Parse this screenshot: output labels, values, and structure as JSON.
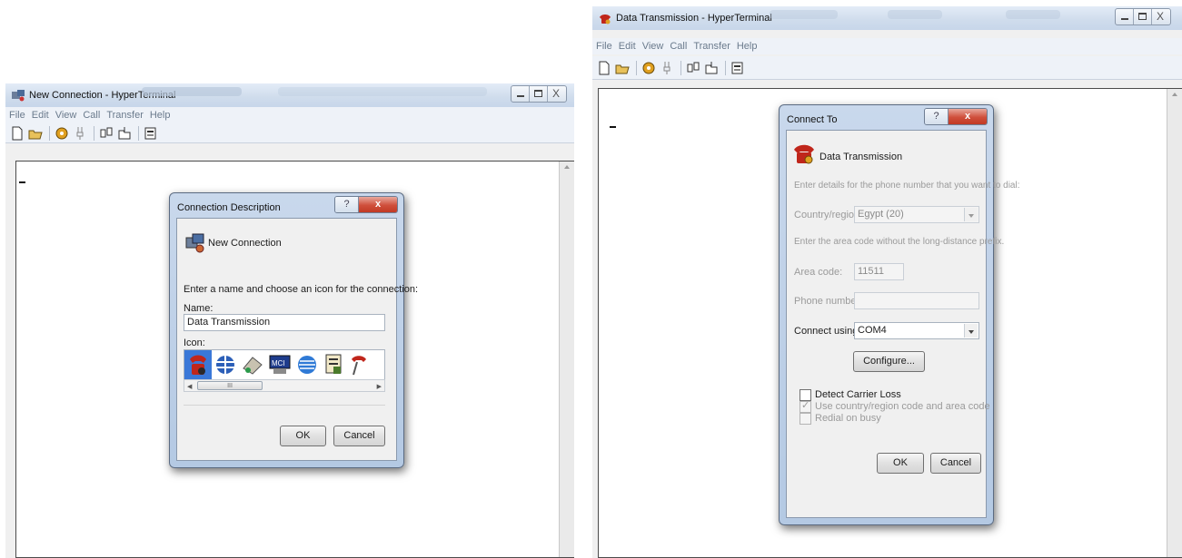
{
  "left_window": {
    "title": "New Connection - HyperTerminal",
    "menu": [
      "File",
      "Edit",
      "View",
      "Call",
      "Transfer",
      "Help"
    ],
    "dialog": {
      "title": "Connection Description",
      "help_glyph": "?",
      "close_glyph": "x",
      "header": "New Connection",
      "instruction": "Enter a name and choose an icon for the connection:",
      "name_label": "Name:",
      "name_value": "Data Transmission",
      "icon_label": "Icon:",
      "icon_names": [
        "phone-icon",
        "globe-icon",
        "dataset-icon",
        "mci-icon",
        "att-icon",
        "notebook-icon",
        "phone-red-icon"
      ],
      "mci_text": "MCI",
      "scroll_thumb": "III",
      "ok": "OK",
      "cancel": "Cancel"
    }
  },
  "right_window": {
    "title": "Data Transmission - HyperTerminal",
    "menu": [
      "File",
      "Edit",
      "View",
      "Call",
      "Transfer",
      "Help"
    ],
    "dialog": {
      "title": "Connect To",
      "help_glyph": "?",
      "close_glyph": "x",
      "header": "Data Transmission",
      "phone_details": "Enter details for the phone number that you want to dial:",
      "country_label": "Country/region:",
      "country_value": "Egypt (20)",
      "area_hint": "Enter the area code without the long-distance prefix.",
      "area_label": "Area code:",
      "area_value": "11511",
      "phone_label": "Phone number:",
      "phone_value": "",
      "connect_label": "Connect using:",
      "connect_value": "COM4",
      "configure": "Configure...",
      "detect_carrier": "Detect Carrier Loss",
      "use_country": "Use country/region code and area code",
      "redial": "Redial on busy",
      "use_country_checked": true,
      "ok": "OK",
      "cancel": "Cancel"
    }
  },
  "window_controls": {
    "min": "minimize-icon",
    "max": "maximize-icon",
    "close_glyph": "X"
  }
}
